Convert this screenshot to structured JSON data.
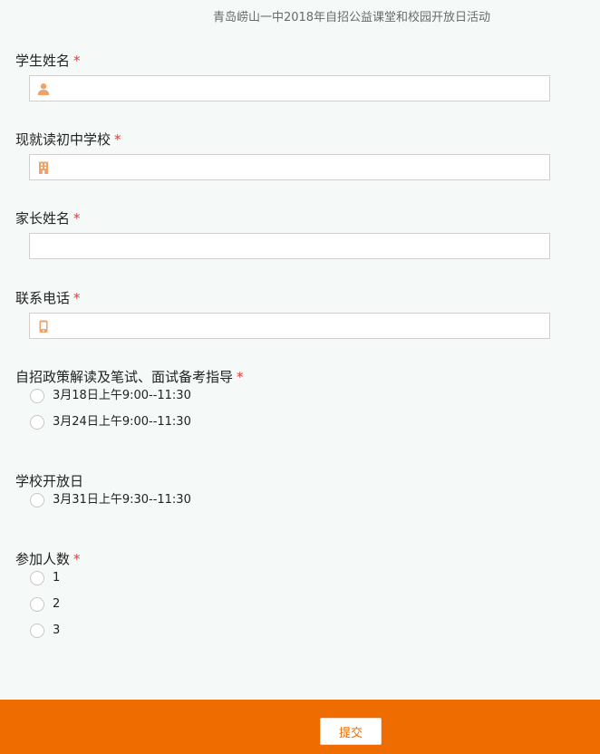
{
  "form": {
    "title": "青岛崂山一中2018年自招公益课堂和校园开放日活动",
    "required_mark": "*"
  },
  "fields": {
    "student_name": {
      "label": "学生姓名",
      "value": "",
      "icon": "person-icon"
    },
    "school": {
      "label": "现就读初中学校",
      "value": "",
      "icon": "building-icon"
    },
    "parent_name": {
      "label": "家长姓名",
      "value": ""
    },
    "phone": {
      "label": "联系电话",
      "value": "",
      "icon": "mobile-phone-icon"
    },
    "policy_session": {
      "label": "自招政策解读及笔试、面试备考指导",
      "options": [
        "3月18日上午9:00--11:30",
        "3月24日上午9:00--11:30"
      ]
    },
    "open_day": {
      "label": "学校开放日",
      "options": [
        "3月31日上午9:30--11:30"
      ]
    },
    "attendees": {
      "label": "参加人数",
      "options": [
        "1",
        "2",
        "3"
      ]
    }
  },
  "footer": {
    "submit_label": "提交"
  },
  "colors": {
    "accent": "#ee6c00",
    "icon": "#f0a26a",
    "required": "#e53935",
    "background": "#f5f9f8"
  }
}
